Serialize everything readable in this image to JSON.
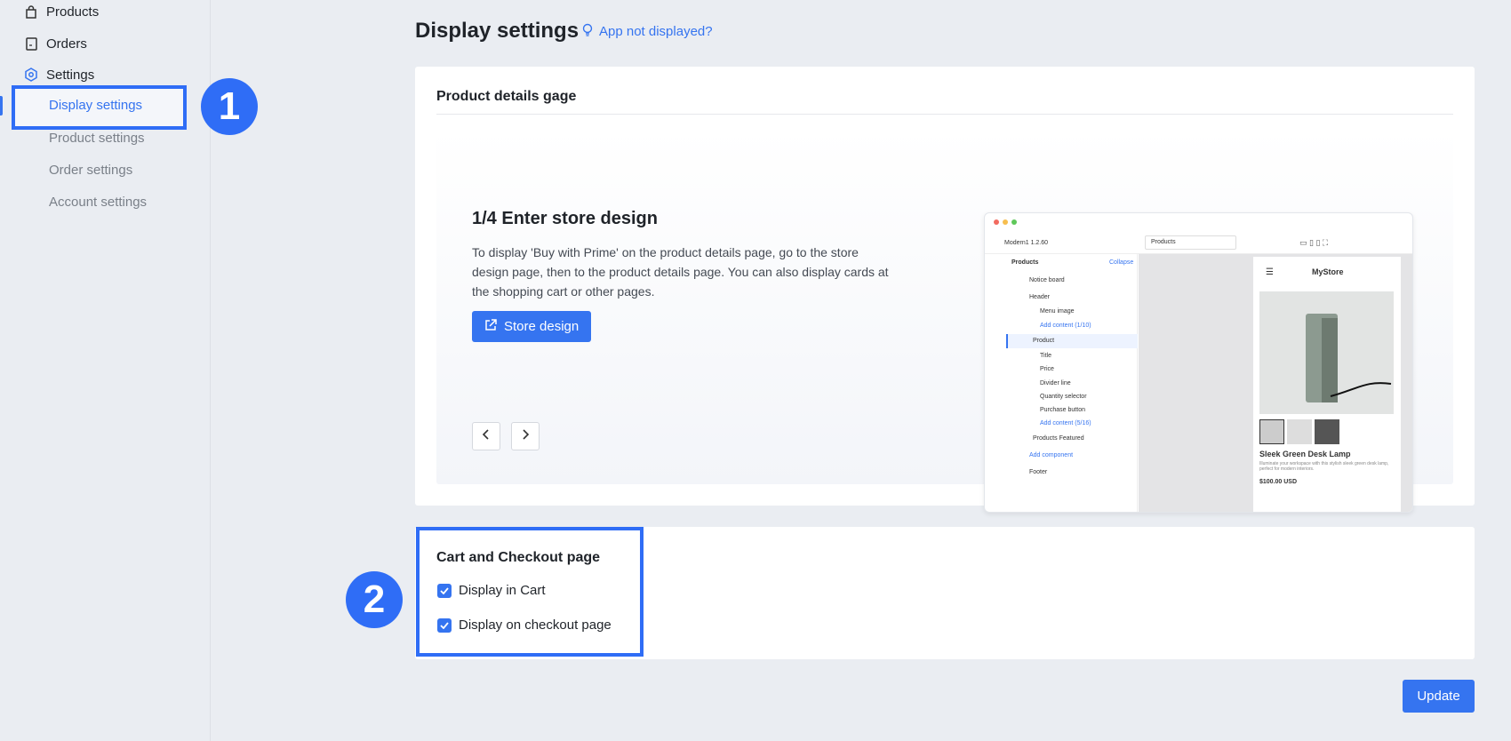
{
  "sidebar": {
    "items": [
      {
        "label": "Products",
        "icon": "bag-icon"
      },
      {
        "label": "Orders",
        "icon": "receipt-icon"
      },
      {
        "label": "Settings",
        "icon": "settings-icon"
      }
    ],
    "sub_items": [
      "Display settings",
      "Product settings",
      "Order settings",
      "Account settings"
    ],
    "active": "Display settings"
  },
  "badges": [
    "1",
    "2"
  ],
  "header": {
    "title": "Display settings",
    "help_link": "App not displayed?"
  },
  "product_card": {
    "title": "Product details gage",
    "step_title": "1/4 Enter store design",
    "step_desc": "To display 'Buy with Prime' on the product details page, go to the store design page, then to the product details page. You can also display cards at the shopping cart or other pages.",
    "button_label": "Store design"
  },
  "preview": {
    "theme": "Modern1 1.2.60",
    "page_select": "Products",
    "panel_title": "Products",
    "collapse": "Collapse",
    "tree": [
      "Notice board",
      "Header",
      "Menu image",
      "Add content (1/10)",
      "Product",
      "Title",
      "Price",
      "Divider line",
      "Quantity selector",
      "Purchase button",
      "Add content (5/16)",
      "Products Featured",
      "Add component",
      "Footer"
    ],
    "store_name": "MyStore",
    "product_name": "Sleek Green Desk Lamp",
    "product_desc": "Illuminate your workspace with this stylish sleek green desk lamp, perfect for modern interiors.",
    "price": "$100.00 USD"
  },
  "cart_card": {
    "title": "Cart and Checkout page",
    "options": [
      {
        "label": "Display in Cart",
        "checked": true
      },
      {
        "label": "Display on checkout page",
        "checked": true
      }
    ]
  },
  "update_label": "Update",
  "colors": {
    "accent": "#3574f0",
    "highlight": "#2f6df6",
    "background": "#eaedf2"
  }
}
